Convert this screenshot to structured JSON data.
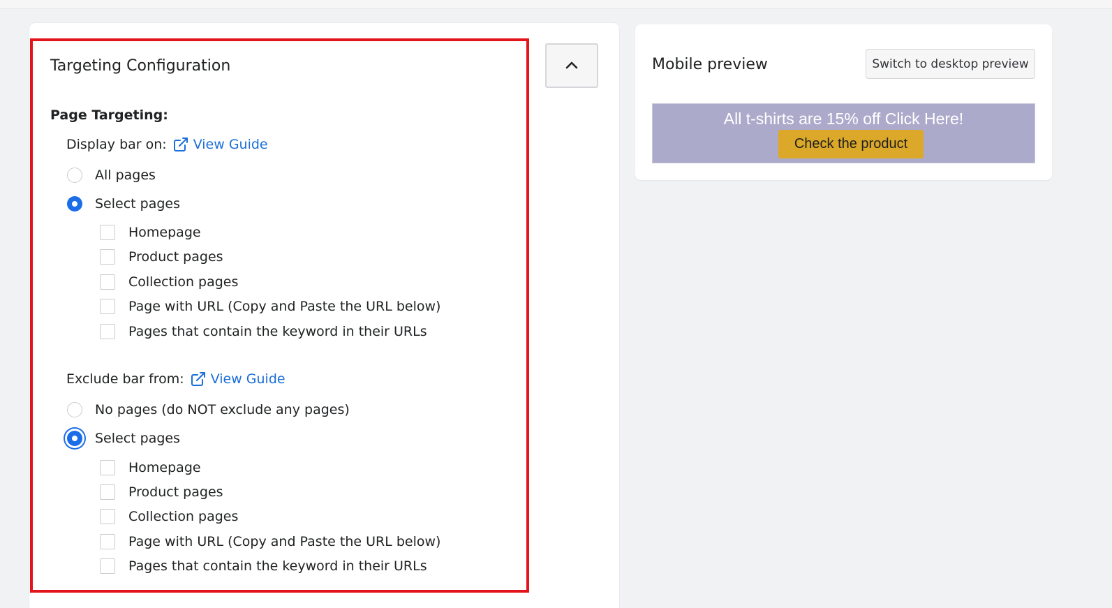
{
  "targeting": {
    "title": "Targeting Configuration",
    "section_label": "Page Targeting:",
    "display": {
      "label": "Display bar on:",
      "guide_label": "View Guide",
      "options": [
        {
          "label": "All pages",
          "selected": false
        },
        {
          "label": "Select pages",
          "selected": true
        }
      ],
      "pages": [
        "Homepage",
        "Product pages",
        "Collection pages",
        "Page with URL (Copy and Paste the URL below)",
        "Pages that contain the keyword in their URLs"
      ]
    },
    "exclude": {
      "label": "Exclude bar from:",
      "guide_label": "View Guide",
      "options": [
        {
          "label": "No pages (do NOT exclude any pages)",
          "selected": false
        },
        {
          "label": "Select pages",
          "selected": true
        }
      ],
      "pages": [
        "Homepage",
        "Product pages",
        "Collection pages",
        "Page with URL (Copy and Paste the URL below)",
        "Pages that contain the keyword in their URLs"
      ]
    }
  },
  "preview": {
    "title": "Mobile preview",
    "switch_label": "Switch to desktop preview",
    "bar_text": "All t-shirts are 15% off Click Here!",
    "cta_label": "Check the product",
    "bar_color": "#abaacb",
    "cta_color": "#dba829"
  },
  "colors": {
    "accent": "#1c6ee8",
    "link": "#1a6ed8",
    "highlight": "#e3141b"
  },
  "icons": {
    "collapse": "chevron-up-icon",
    "guide": "external-link-icon"
  }
}
